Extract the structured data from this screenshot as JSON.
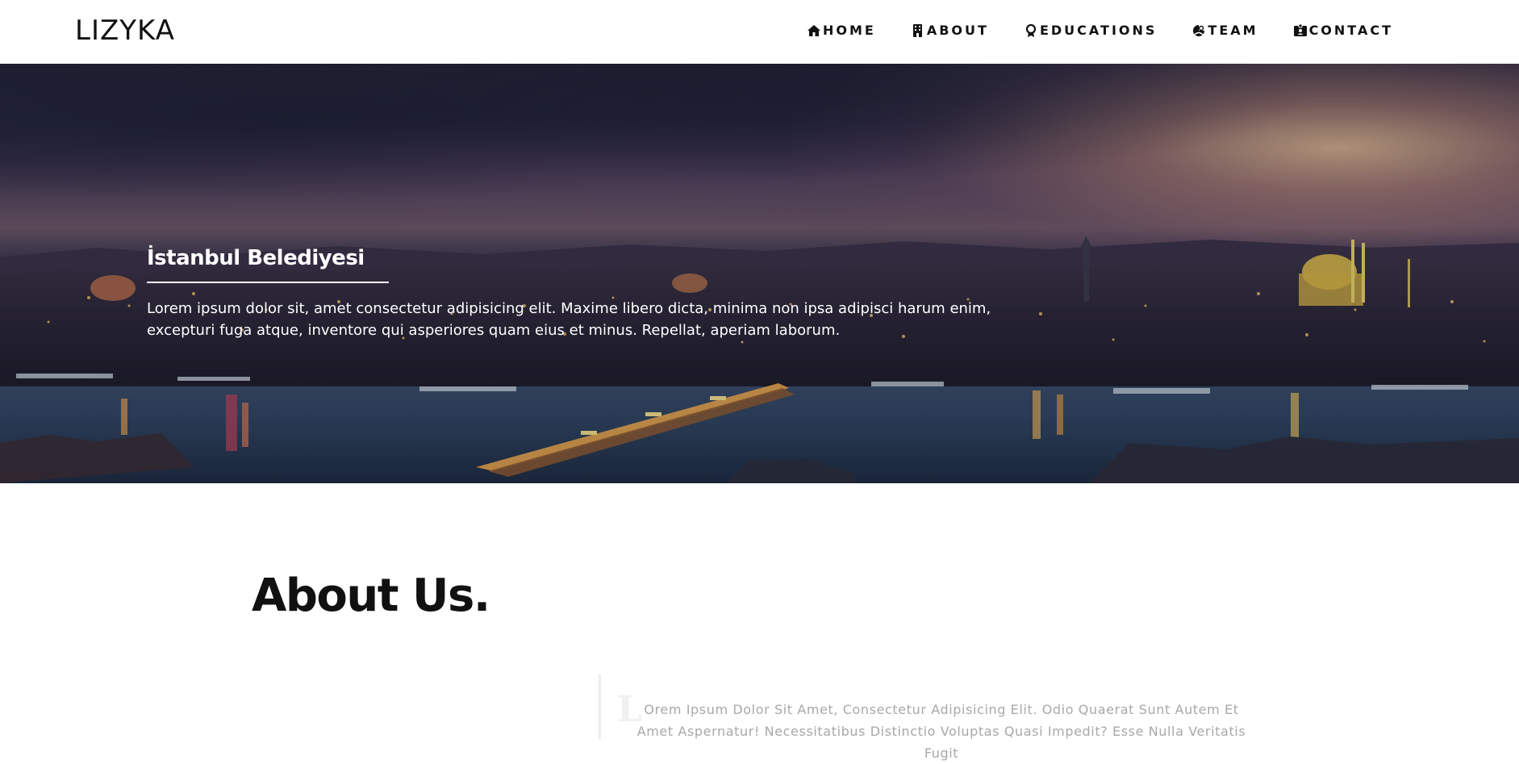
{
  "navbar": {
    "brand": "LIZYKA",
    "items": [
      {
        "label": "HOME",
        "icon": "home-icon"
      },
      {
        "label": "ABOUT",
        "icon": "building-icon"
      },
      {
        "label": "EDUCATIONS",
        "icon": "award-icon"
      },
      {
        "label": "TEAM",
        "icon": "team-icon"
      },
      {
        "label": "CONTACT",
        "icon": "contact-card-icon"
      }
    ]
  },
  "hero": {
    "title": "İstanbul Belediyesi",
    "text": "Lorem ipsum dolor sit, amet consectetur adipisicing elit. Maxime libero dicta, minima non ipsa adipisci harum enim, excepturi fuga atque, inventore qui asperiores quam eius et minus. Repellat, aperiam laborum."
  },
  "about": {
    "title": "About Us.",
    "dropcap": "L",
    "text": "Orem Ipsum Dolor Sit Amet, Consectetur Adipisicing Elit. Odio Quaerat Sunt Autem Et Amet Aspernatur! Necessitatibus Distinctio Voluptas Quasi Impedit? Esse Nulla Veritatis Fugit"
  }
}
